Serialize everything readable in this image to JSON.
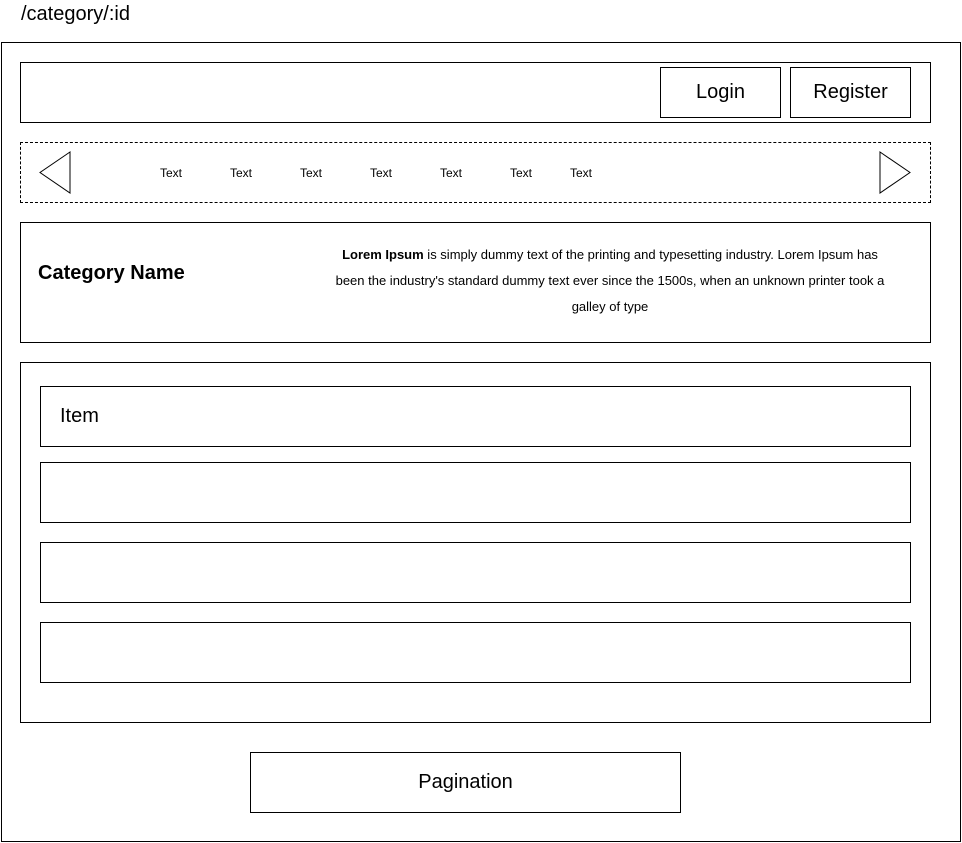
{
  "route": "/category/:id",
  "header": {
    "login_label": "Login",
    "register_label": "Register"
  },
  "category_nav": {
    "items": [
      "Text",
      "Text",
      "Text",
      "Text",
      "Text",
      "Text",
      "Text"
    ]
  },
  "category_info": {
    "name": "Category Name",
    "description_bold": "Lorem Ipsum",
    "description_rest": " is simply dummy text of the printing and typesetting industry. Lorem Ipsum has been the industry's standard dummy text ever since the 1500s, when an unknown printer took a galley of type"
  },
  "item_list": {
    "items": [
      "Item",
      "",
      "",
      ""
    ]
  },
  "pagination": {
    "label": "Pagination"
  }
}
